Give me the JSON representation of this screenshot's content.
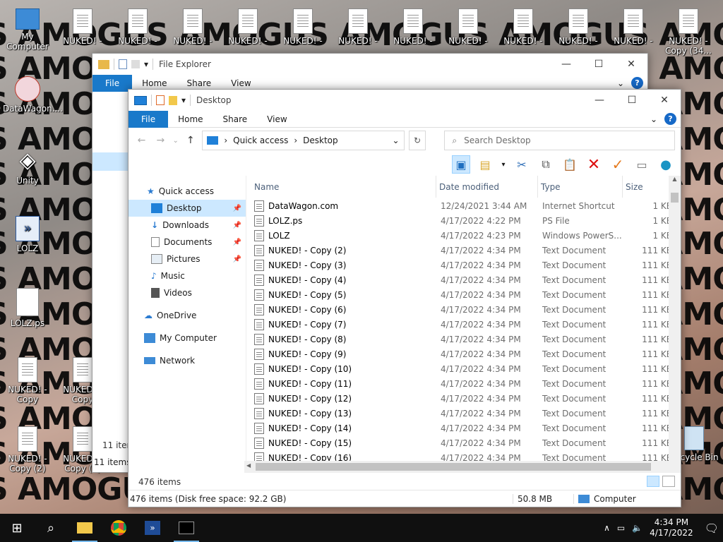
{
  "wallpaper_text": "S AMOGUS AMOGUS AMOGUS AMOGUS AMOGUS AMOGUS",
  "desktop_icons": {
    "my_computer": "My Computer",
    "datawagon": "DataWagon....",
    "unity": "Unity",
    "lolz": "LOLZ",
    "lolz_ps": "LOLZ.ps",
    "nuked_copy": "NUKED! - Copy",
    "nuked_copy2": "NUKED! - Copy (2)",
    "nuked_copy9": "NUKED! - Copy (9)",
    "nuked_top": "NUKED! -",
    "nuked_copy34": "NUKED! - Copy (34...",
    "recycle_bin": "Recycle Bin"
  },
  "back_window": {
    "title": "File Explorer",
    "ribbon": {
      "file": "File",
      "home": "Home",
      "share": "Share",
      "view": "View"
    },
    "status_items": "11 items",
    "status_items2": "11 items"
  },
  "window": {
    "title": "Desktop",
    "ribbon": {
      "file": "File",
      "home": "Home",
      "share": "Share",
      "view": "View"
    },
    "breadcrumb": [
      "Quick access",
      "Desktop"
    ],
    "search_placeholder": "Search Desktop",
    "columns": {
      "name": "Name",
      "date": "Date modified",
      "type": "Type",
      "size": "Size"
    },
    "nav": {
      "quick_access": "Quick access",
      "desktop": "Desktop",
      "downloads": "Downloads",
      "documents": "Documents",
      "pictures": "Pictures",
      "music": "Music",
      "videos": "Videos",
      "onedrive": "OneDrive",
      "my_computer": "My Computer",
      "network": "Network"
    },
    "rows": [
      {
        "name": "DataWagon.com",
        "date": "12/24/2021 3:44 AM",
        "type": "Internet Shortcut",
        "size": "1 KB"
      },
      {
        "name": "LOLZ.ps",
        "date": "4/17/2022 4:22 PM",
        "type": "PS File",
        "size": "1 KB"
      },
      {
        "name": "LOLZ",
        "date": "4/17/2022 4:23 PM",
        "type": "Windows PowerS...",
        "size": "1 KB"
      },
      {
        "name": "NUKED! - Copy (2)",
        "date": "4/17/2022 4:34 PM",
        "type": "Text Document",
        "size": "111 KB"
      },
      {
        "name": "NUKED! - Copy (3)",
        "date": "4/17/2022 4:34 PM",
        "type": "Text Document",
        "size": "111 KB"
      },
      {
        "name": "NUKED! - Copy (4)",
        "date": "4/17/2022 4:34 PM",
        "type": "Text Document",
        "size": "111 KB"
      },
      {
        "name": "NUKED! - Copy (5)",
        "date": "4/17/2022 4:34 PM",
        "type": "Text Document",
        "size": "111 KB"
      },
      {
        "name": "NUKED! - Copy (6)",
        "date": "4/17/2022 4:34 PM",
        "type": "Text Document",
        "size": "111 KB"
      },
      {
        "name": "NUKED! - Copy (7)",
        "date": "4/17/2022 4:34 PM",
        "type": "Text Document",
        "size": "111 KB"
      },
      {
        "name": "NUKED! - Copy (8)",
        "date": "4/17/2022 4:34 PM",
        "type": "Text Document",
        "size": "111 KB"
      },
      {
        "name": "NUKED! - Copy (9)",
        "date": "4/17/2022 4:34 PM",
        "type": "Text Document",
        "size": "111 KB"
      },
      {
        "name": "NUKED! - Copy (10)",
        "date": "4/17/2022 4:34 PM",
        "type": "Text Document",
        "size": "111 KB"
      },
      {
        "name": "NUKED! - Copy (11)",
        "date": "4/17/2022 4:34 PM",
        "type": "Text Document",
        "size": "111 KB"
      },
      {
        "name": "NUKED! - Copy (12)",
        "date": "4/17/2022 4:34 PM",
        "type": "Text Document",
        "size": "111 KB"
      },
      {
        "name": "NUKED! - Copy (13)",
        "date": "4/17/2022 4:34 PM",
        "type": "Text Document",
        "size": "111 KB"
      },
      {
        "name": "NUKED! - Copy (14)",
        "date": "4/17/2022 4:34 PM",
        "type": "Text Document",
        "size": "111 KB"
      },
      {
        "name": "NUKED! - Copy (15)",
        "date": "4/17/2022 4:34 PM",
        "type": "Text Document",
        "size": "111 KB"
      },
      {
        "name": "NUKED! - Copy (16)",
        "date": "4/17/2022 4:34 PM",
        "type": "Text Document",
        "size": "111 KB"
      }
    ],
    "item_count": "476 items",
    "status_bar": {
      "left": "476 items (Disk free space: 92.2 GB)",
      "size": "50.8 MB",
      "location": "Computer"
    }
  },
  "taskbar": {
    "time": "4:34 PM",
    "date": "4/17/2022"
  },
  "colors": {
    "accent": "#1979ca",
    "selected": "#cce8ff",
    "taskbar": "#101010"
  }
}
